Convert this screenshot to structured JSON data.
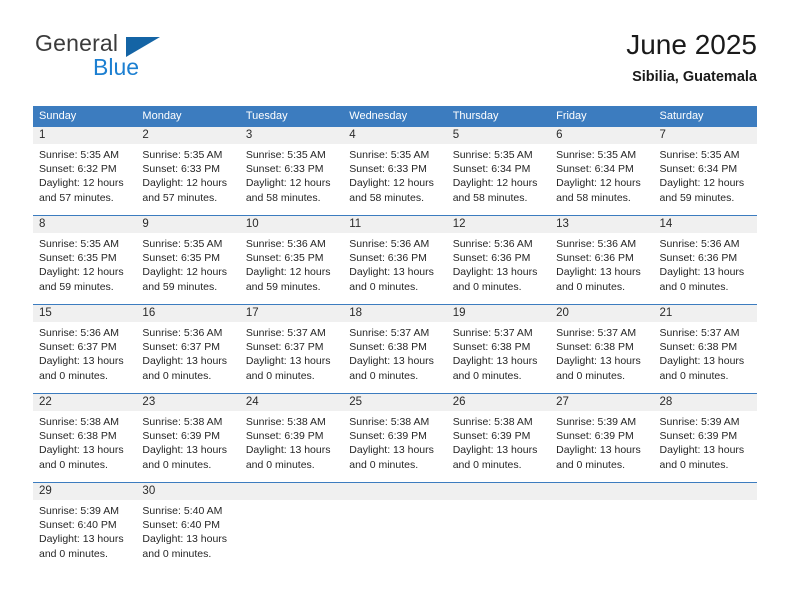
{
  "brand": {
    "name_top": "General",
    "name_bottom": "Blue",
    "triangle_color": "#1464a5",
    "blue_color": "#1c7fd1"
  },
  "header": {
    "title": "June 2025",
    "subtitle": "Sibilia, Guatemala"
  },
  "theme": {
    "header_blue": "#3c7cbf",
    "daynum_band": "#f0f0f0",
    "row_divider": "#3c7cbf",
    "text": "#262626"
  },
  "calendar": {
    "weekday_headers": [
      "Sunday",
      "Monday",
      "Tuesday",
      "Wednesday",
      "Thursday",
      "Friday",
      "Saturday"
    ],
    "weeks": [
      [
        {
          "day": "1",
          "sunrise": "Sunrise: 5:35 AM",
          "sunset": "Sunset: 6:32 PM",
          "daylight": "Daylight: 12 hours and 57 minutes."
        },
        {
          "day": "2",
          "sunrise": "Sunrise: 5:35 AM",
          "sunset": "Sunset: 6:33 PM",
          "daylight": "Daylight: 12 hours and 57 minutes."
        },
        {
          "day": "3",
          "sunrise": "Sunrise: 5:35 AM",
          "sunset": "Sunset: 6:33 PM",
          "daylight": "Daylight: 12 hours and 58 minutes."
        },
        {
          "day": "4",
          "sunrise": "Sunrise: 5:35 AM",
          "sunset": "Sunset: 6:33 PM",
          "daylight": "Daylight: 12 hours and 58 minutes."
        },
        {
          "day": "5",
          "sunrise": "Sunrise: 5:35 AM",
          "sunset": "Sunset: 6:34 PM",
          "daylight": "Daylight: 12 hours and 58 minutes."
        },
        {
          "day": "6",
          "sunrise": "Sunrise: 5:35 AM",
          "sunset": "Sunset: 6:34 PM",
          "daylight": "Daylight: 12 hours and 58 minutes."
        },
        {
          "day": "7",
          "sunrise": "Sunrise: 5:35 AM",
          "sunset": "Sunset: 6:34 PM",
          "daylight": "Daylight: 12 hours and 59 minutes."
        }
      ],
      [
        {
          "day": "8",
          "sunrise": "Sunrise: 5:35 AM",
          "sunset": "Sunset: 6:35 PM",
          "daylight": "Daylight: 12 hours and 59 minutes."
        },
        {
          "day": "9",
          "sunrise": "Sunrise: 5:35 AM",
          "sunset": "Sunset: 6:35 PM",
          "daylight": "Daylight: 12 hours and 59 minutes."
        },
        {
          "day": "10",
          "sunrise": "Sunrise: 5:36 AM",
          "sunset": "Sunset: 6:35 PM",
          "daylight": "Daylight: 12 hours and 59 minutes."
        },
        {
          "day": "11",
          "sunrise": "Sunrise: 5:36 AM",
          "sunset": "Sunset: 6:36 PM",
          "daylight": "Daylight: 13 hours and 0 minutes."
        },
        {
          "day": "12",
          "sunrise": "Sunrise: 5:36 AM",
          "sunset": "Sunset: 6:36 PM",
          "daylight": "Daylight: 13 hours and 0 minutes."
        },
        {
          "day": "13",
          "sunrise": "Sunrise: 5:36 AM",
          "sunset": "Sunset: 6:36 PM",
          "daylight": "Daylight: 13 hours and 0 minutes."
        },
        {
          "day": "14",
          "sunrise": "Sunrise: 5:36 AM",
          "sunset": "Sunset: 6:36 PM",
          "daylight": "Daylight: 13 hours and 0 minutes."
        }
      ],
      [
        {
          "day": "15",
          "sunrise": "Sunrise: 5:36 AM",
          "sunset": "Sunset: 6:37 PM",
          "daylight": "Daylight: 13 hours and 0 minutes."
        },
        {
          "day": "16",
          "sunrise": "Sunrise: 5:36 AM",
          "sunset": "Sunset: 6:37 PM",
          "daylight": "Daylight: 13 hours and 0 minutes."
        },
        {
          "day": "17",
          "sunrise": "Sunrise: 5:37 AM",
          "sunset": "Sunset: 6:37 PM",
          "daylight": "Daylight: 13 hours and 0 minutes."
        },
        {
          "day": "18",
          "sunrise": "Sunrise: 5:37 AM",
          "sunset": "Sunset: 6:38 PM",
          "daylight": "Daylight: 13 hours and 0 minutes."
        },
        {
          "day": "19",
          "sunrise": "Sunrise: 5:37 AM",
          "sunset": "Sunset: 6:38 PM",
          "daylight": "Daylight: 13 hours and 0 minutes."
        },
        {
          "day": "20",
          "sunrise": "Sunrise: 5:37 AM",
          "sunset": "Sunset: 6:38 PM",
          "daylight": "Daylight: 13 hours and 0 minutes."
        },
        {
          "day": "21",
          "sunrise": "Sunrise: 5:37 AM",
          "sunset": "Sunset: 6:38 PM",
          "daylight": "Daylight: 13 hours and 0 minutes."
        }
      ],
      [
        {
          "day": "22",
          "sunrise": "Sunrise: 5:38 AM",
          "sunset": "Sunset: 6:38 PM",
          "daylight": "Daylight: 13 hours and 0 minutes."
        },
        {
          "day": "23",
          "sunrise": "Sunrise: 5:38 AM",
          "sunset": "Sunset: 6:39 PM",
          "daylight": "Daylight: 13 hours and 0 minutes."
        },
        {
          "day": "24",
          "sunrise": "Sunrise: 5:38 AM",
          "sunset": "Sunset: 6:39 PM",
          "daylight": "Daylight: 13 hours and 0 minutes."
        },
        {
          "day": "25",
          "sunrise": "Sunrise: 5:38 AM",
          "sunset": "Sunset: 6:39 PM",
          "daylight": "Daylight: 13 hours and 0 minutes."
        },
        {
          "day": "26",
          "sunrise": "Sunrise: 5:38 AM",
          "sunset": "Sunset: 6:39 PM",
          "daylight": "Daylight: 13 hours and 0 minutes."
        },
        {
          "day": "27",
          "sunrise": "Sunrise: 5:39 AM",
          "sunset": "Sunset: 6:39 PM",
          "daylight": "Daylight: 13 hours and 0 minutes."
        },
        {
          "day": "28",
          "sunrise": "Sunrise: 5:39 AM",
          "sunset": "Sunset: 6:39 PM",
          "daylight": "Daylight: 13 hours and 0 minutes."
        }
      ],
      [
        {
          "day": "29",
          "sunrise": "Sunrise: 5:39 AM",
          "sunset": "Sunset: 6:40 PM",
          "daylight": "Daylight: 13 hours and 0 minutes."
        },
        {
          "day": "30",
          "sunrise": "Sunrise: 5:40 AM",
          "sunset": "Sunset: 6:40 PM",
          "daylight": "Daylight: 13 hours and 0 minutes."
        },
        {
          "day": "",
          "sunrise": "",
          "sunset": "",
          "daylight": ""
        },
        {
          "day": "",
          "sunrise": "",
          "sunset": "",
          "daylight": ""
        },
        {
          "day": "",
          "sunrise": "",
          "sunset": "",
          "daylight": ""
        },
        {
          "day": "",
          "sunrise": "",
          "sunset": "",
          "daylight": ""
        },
        {
          "day": "",
          "sunrise": "",
          "sunset": "",
          "daylight": ""
        }
      ]
    ]
  }
}
